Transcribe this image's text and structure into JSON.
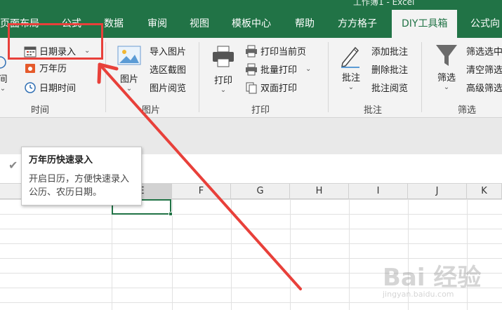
{
  "app": {
    "title": "工作簿1 - Excel"
  },
  "tabs": [
    {
      "label": "页面布局"
    },
    {
      "label": "公式"
    },
    {
      "label": "数据"
    },
    {
      "label": "审阅"
    },
    {
      "label": "视图"
    },
    {
      "label": "模板中心"
    },
    {
      "label": "帮助"
    },
    {
      "label": "方方格子"
    },
    {
      "label": "DIY工具箱"
    },
    {
      "label": "公式向"
    }
  ],
  "ribbon": {
    "time": {
      "partial_label": "间",
      "date_entry": "日期录入",
      "calendar": "万年历",
      "date_time": "日期时间",
      "group": "时间"
    },
    "picture": {
      "big_button": "图片",
      "import": "导入图片",
      "region_capture": "选区截图",
      "browse": "图片阅览",
      "group": "图片"
    },
    "print": {
      "big_button": "打印",
      "current_page": "打印当前页",
      "batch": "批量打印",
      "duplex": "双面打印",
      "group": "打印"
    },
    "comment": {
      "big_button": "批注",
      "add": "添加批注",
      "delete": "删除批注",
      "browse": "批注阅览",
      "group": "批注"
    },
    "filter": {
      "big_button": "筛选",
      "select_filter": "筛选选中",
      "clear_filter": "清空筛选",
      "advanced": "高级筛选",
      "group": "筛选"
    }
  },
  "tooltip": {
    "title": "万年历快速录入",
    "body": "开启日历，方便快速录入公历、农历日期。"
  },
  "grid": {
    "columns": [
      "E",
      "F",
      "G",
      "H",
      "I",
      "J",
      "K"
    ]
  },
  "watermark": {
    "main": "Bai 经验",
    "sub": "jingyan.baidu.com"
  },
  "colors": {
    "accent": "#217346",
    "annotation": "#e8403a"
  }
}
